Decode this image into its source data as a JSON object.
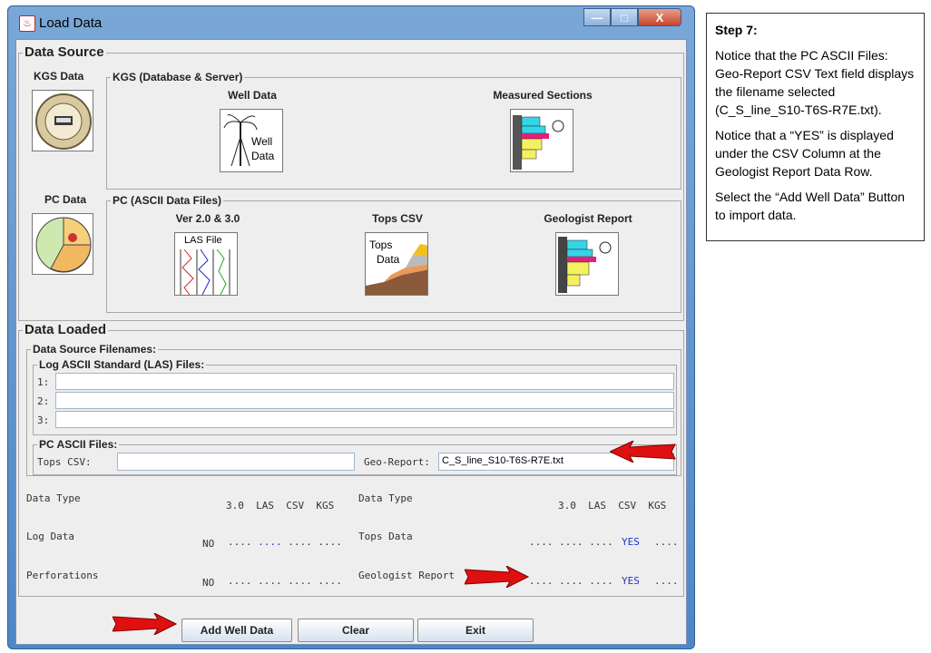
{
  "window": {
    "title": "Load Data",
    "minimize": "—",
    "maximize": "□",
    "close": "X"
  },
  "data_source": {
    "title": "Data Source",
    "kgs_data_label": "KGS Data",
    "kgs_group": {
      "title": "KGS (Database & Server)",
      "well_data_label": "Well Data",
      "well_icon_text": [
        "Well",
        "Data"
      ],
      "measured_sections_label": "Measured Sections"
    },
    "pc_data_label": "PC Data",
    "pc_group": {
      "title": "PC (ASCII Data Files)",
      "ver_label": "Ver 2.0 & 3.0",
      "las_icon_text": "LAS File",
      "tops_label": "Tops CSV",
      "tops_icon_text": [
        "Tops",
        "Data"
      ],
      "geo_report_label": "Geologist Report"
    }
  },
  "data_loaded": {
    "title": "Data Loaded",
    "filenames_title": "Data Source Filenames:",
    "las_title": "Log ASCII Standard (LAS) Files:",
    "las_rows": [
      {
        "label": "1:",
        "value": ""
      },
      {
        "label": "2:",
        "value": ""
      },
      {
        "label": "3:",
        "value": ""
      }
    ],
    "pc_title": "PC ASCII Files:",
    "tops_csv_label": "Tops CSV:",
    "tops_csv_value": "",
    "geo_report_label": "Geo-Report:",
    "geo_report_value": "C_S_line_S10-T6S-R7E.txt"
  },
  "status_table": {
    "left": {
      "header": "Data Type",
      "columns": "3.0  LAS  CSV  KGS",
      "rows": [
        {
          "name": "Log Data",
          "no": "NO",
          "dots": ".... .... .... ....",
          "blue_dots": true
        },
        {
          "name": "Perforations",
          "no": "NO",
          "dots": ".... .... .... ....",
          "blue_dots": false
        }
      ]
    },
    "right": {
      "header": "Data Type",
      "columns": "3.0  LAS  CSV  KGS",
      "rows": [
        {
          "name": "Tops Data",
          "dots": ".... .... ....",
          "yes": "YES",
          "tail": "...."
        },
        {
          "name": "Geologist Report",
          "dots": ".... .... ....",
          "yes": "YES",
          "tail": "...."
        }
      ]
    }
  },
  "buttons": {
    "add": "Add Well Data",
    "clear": "Clear",
    "exit": "Exit"
  },
  "instructions": {
    "title": "Step 7:",
    "p1": "Notice that the PC ASCII Files: Geo-Report CSV Text  field displays the filename selected (C_S_line_S10-T6S-R7E.txt).",
    "p2": "Notice that a “YES” is displayed under the CSV Column at the Geologist Report Data Row.",
    "p3": "Select the “Add Well Data” Button to import data."
  },
  "colors": {
    "arrow": "#e01010",
    "yes": "#2233cc"
  }
}
